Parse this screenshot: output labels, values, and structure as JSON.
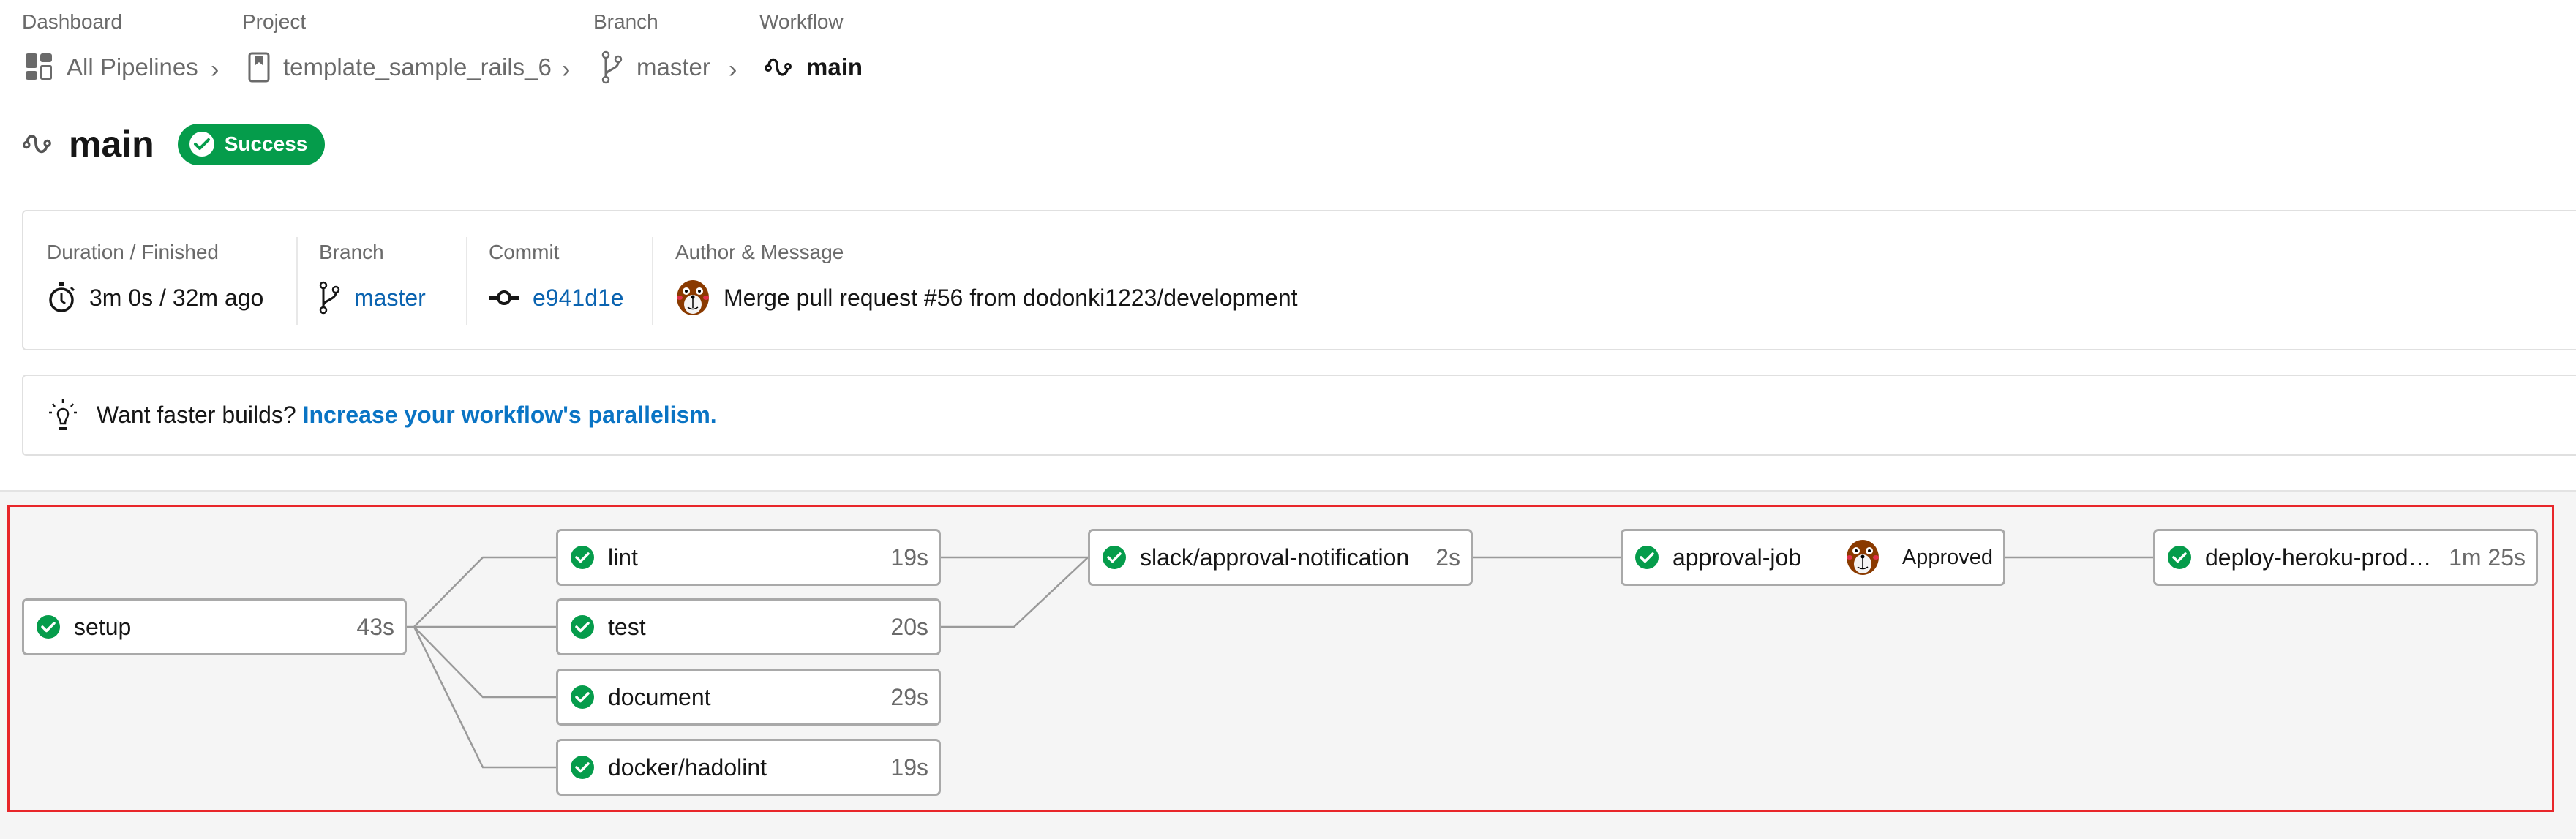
{
  "breadcrumb": {
    "labels": [
      "Dashboard",
      "Project",
      "Branch",
      "Workflow"
    ],
    "items": [
      {
        "label": "All Pipelines",
        "icon": "dashboard-icon"
      },
      {
        "label": "template_sample_rails_6",
        "icon": "project-icon"
      },
      {
        "label": "master",
        "icon": "branch-icon"
      },
      {
        "label": "main",
        "icon": "workflow-icon"
      }
    ]
  },
  "header": {
    "title": "main",
    "status": "Success",
    "status_color": "#059c4b"
  },
  "info": {
    "duration_label": "Duration / Finished",
    "duration_value": "3m 0s / 32m ago",
    "branch_label": "Branch",
    "branch_value": "master",
    "commit_label": "Commit",
    "commit_value": "e941d1e",
    "author_label": "Author & Message",
    "message": "Merge pull request #56 from dodonki1223/development"
  },
  "tip": {
    "text": "Want faster builds?",
    "link": "Increase your workflow's parallelism."
  },
  "graph": {
    "jobs": [
      {
        "id": "setup",
        "name": "setup",
        "duration": "43s",
        "status": "success"
      },
      {
        "id": "lint",
        "name": "lint",
        "duration": "19s",
        "status": "success"
      },
      {
        "id": "test",
        "name": "test",
        "duration": "20s",
        "status": "success"
      },
      {
        "id": "document",
        "name": "document",
        "duration": "29s",
        "status": "success"
      },
      {
        "id": "docker",
        "name": "docker/hadolint",
        "duration": "19s",
        "status": "success"
      },
      {
        "id": "slack",
        "name": "slack/approval-notification",
        "duration": "2s",
        "status": "success"
      },
      {
        "id": "approval",
        "name": "approval-job",
        "approval_status": "Approved",
        "status": "success"
      },
      {
        "id": "deploy",
        "name": "deploy-heroku-produc...",
        "duration": "1m 25s",
        "status": "success"
      }
    ],
    "edges": [
      [
        "setup",
        "lint"
      ],
      [
        "setup",
        "test"
      ],
      [
        "setup",
        "document"
      ],
      [
        "setup",
        "docker"
      ],
      [
        "lint",
        "slack"
      ],
      [
        "test",
        "slack"
      ],
      [
        "slack",
        "approval"
      ],
      [
        "approval",
        "deploy"
      ]
    ]
  }
}
